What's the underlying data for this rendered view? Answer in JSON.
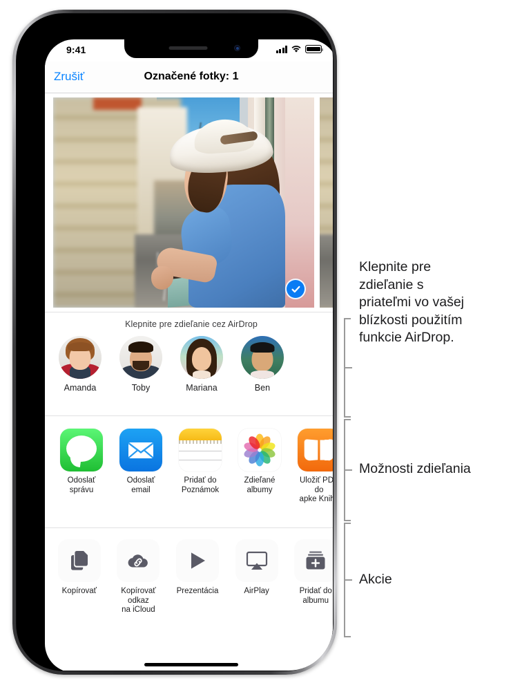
{
  "statusbar": {
    "time": "9:41",
    "signal_icon": "cellular-signal-icon",
    "wifi_icon": "wifi-icon",
    "battery_icon": "battery-full-icon"
  },
  "navbar": {
    "cancel_label": "Zrušiť",
    "title": "Označené fotky: 1"
  },
  "photo": {
    "selected_badge_icon": "checkmark-circle-icon",
    "selected": true
  },
  "airdrop": {
    "hint": "Klepnite pre zdieľanie cez AirDrop",
    "people": [
      {
        "name": "Amanda"
      },
      {
        "name": "Toby"
      },
      {
        "name": "Mariana"
      },
      {
        "name": "Ben"
      }
    ]
  },
  "share_apps": [
    {
      "label": "Odoslať\nsprávu",
      "icon": "messages-icon"
    },
    {
      "label": "Odoslať\nemail",
      "icon": "mail-icon"
    },
    {
      "label": "Pridať do\nPoznámok",
      "icon": "notes-icon"
    },
    {
      "label": "Zdieľané\nalbumy",
      "icon": "photos-icon"
    },
    {
      "label": "Uložiť PDF do\napke Knihy",
      "icon": "books-icon"
    }
  ],
  "actions": [
    {
      "label": "Kopírovať",
      "icon": "copy-icon"
    },
    {
      "label": "Kopírovať odkaz\nna iCloud",
      "icon": "icloud-link-icon"
    },
    {
      "label": "Prezentácia",
      "icon": "play-icon"
    },
    {
      "label": "AirPlay",
      "icon": "airplay-icon"
    },
    {
      "label": "Pridať do\nalbumu",
      "icon": "add-to-album-icon"
    }
  ],
  "callouts": [
    {
      "text": "Klepnite pre\nzdieľanie s\npriateľmi vo vašej\nblízkosti použitím\nfunkcie AirDrop."
    },
    {
      "text": "Možnosti zdieľania"
    },
    {
      "text": "Akcie"
    }
  ],
  "colors": {
    "accent_blue": "#0a84ff",
    "selection_blue": "#0a7cf4",
    "callout_line": "#9a9a9a",
    "screen_bg": "#ffffff"
  }
}
